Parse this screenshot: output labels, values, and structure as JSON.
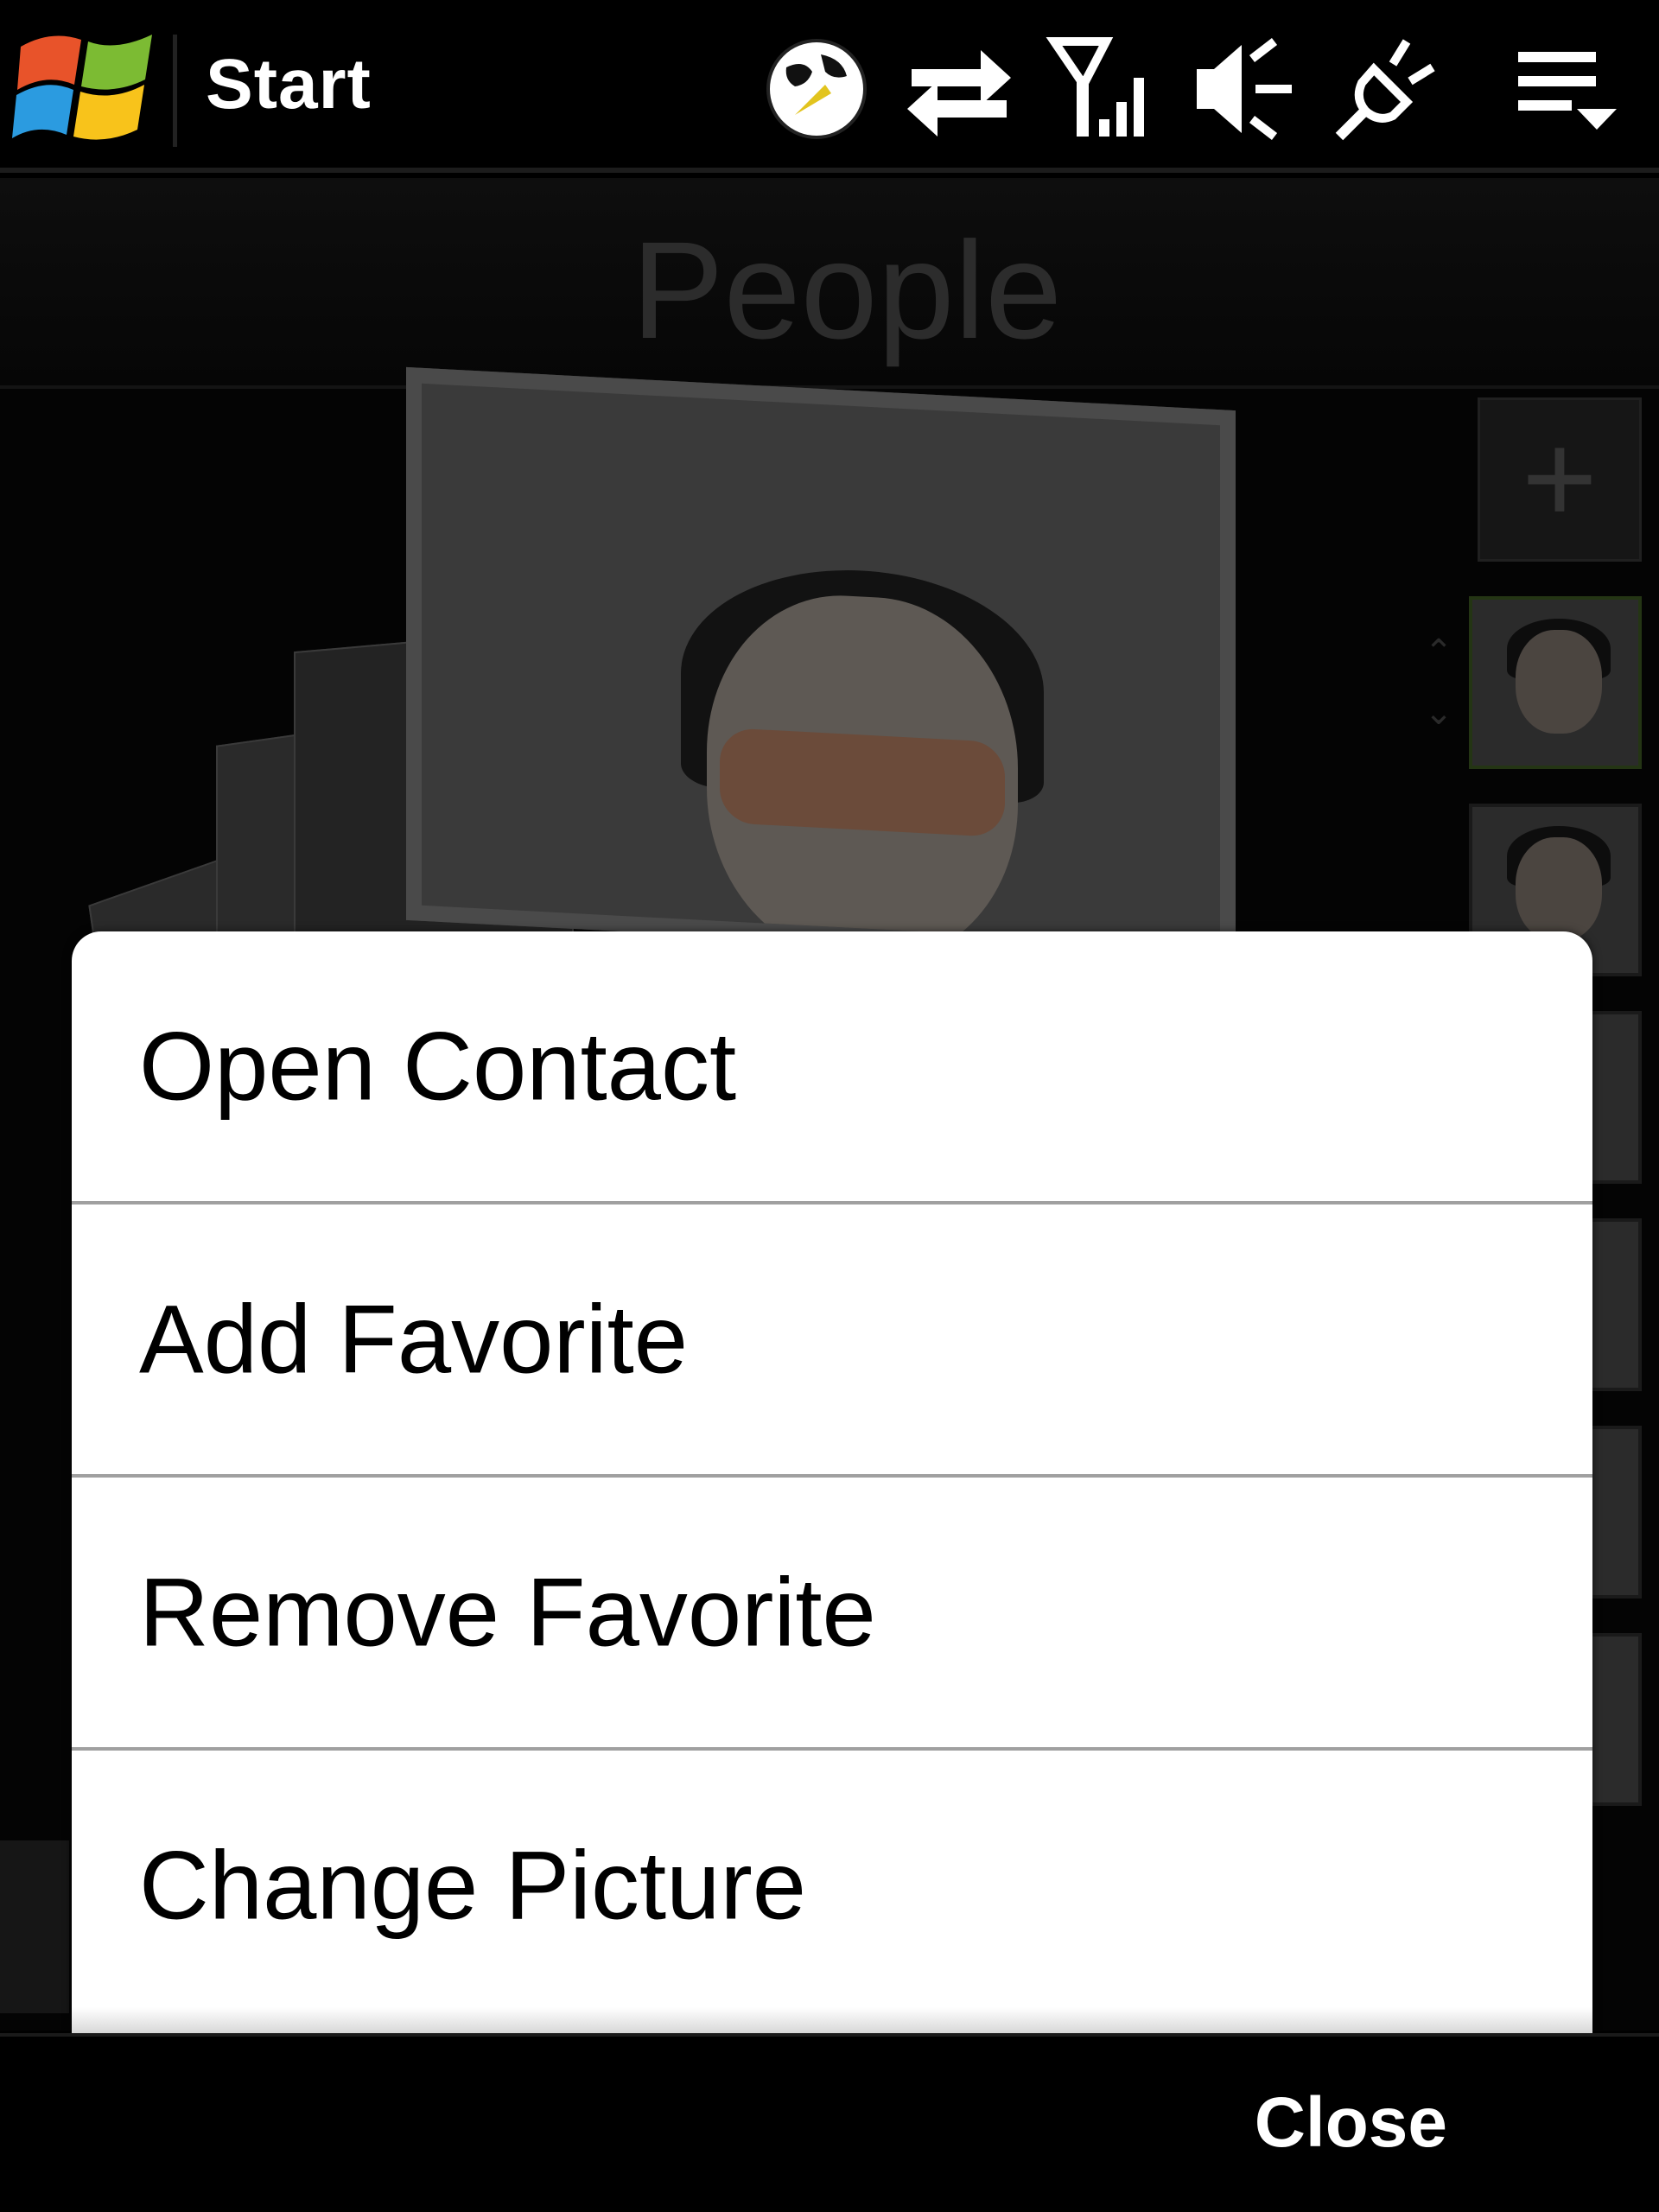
{
  "statusbar": {
    "start_label": "Start",
    "icons": [
      "internet-globe-icon",
      "data-connection-icon",
      "signal-strength-icon",
      "volume-icon",
      "power-plug-icon",
      "notification-menu-icon"
    ]
  },
  "people": {
    "title": "People",
    "add_button": "+"
  },
  "menu": {
    "items": [
      {
        "label": "Open Contact"
      },
      {
        "label": "Add Favorite"
      },
      {
        "label": "Remove Favorite"
      },
      {
        "label": "Change Picture"
      }
    ]
  },
  "bottombar": {
    "close_label": "Close"
  }
}
